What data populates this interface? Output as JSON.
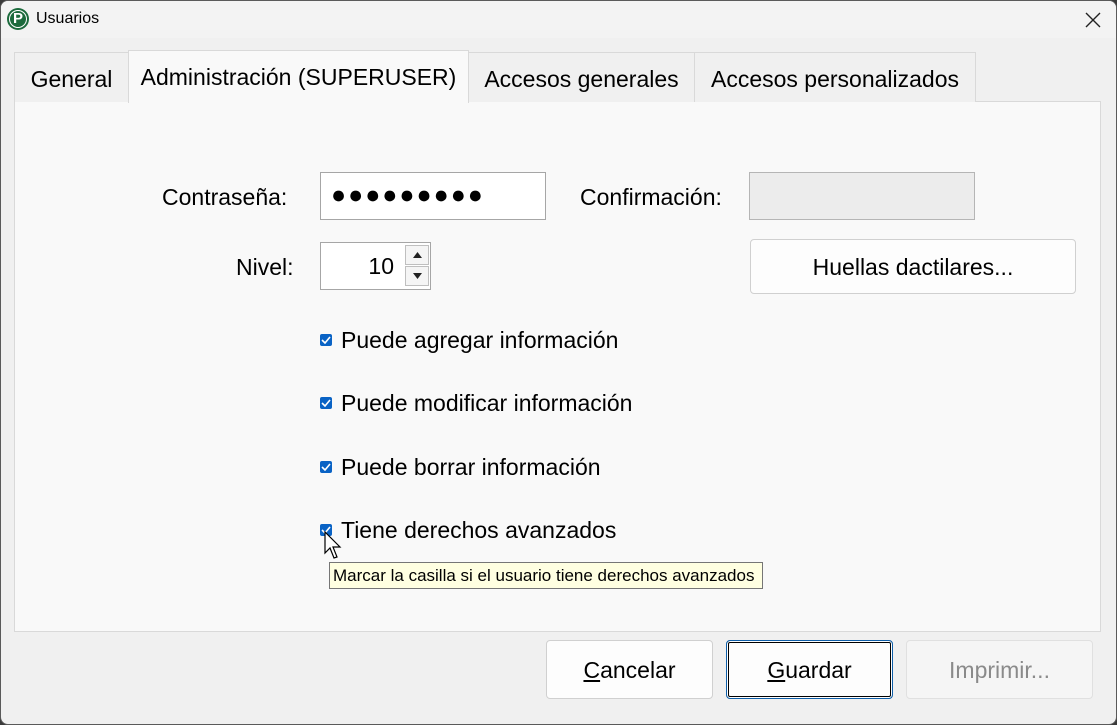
{
  "window": {
    "title": "Usuarios",
    "app_icon": "P"
  },
  "tabs": [
    {
      "label": "General",
      "active": false
    },
    {
      "label": "Administración (SUPERUSER)",
      "active": true
    },
    {
      "label": "Accesos generales",
      "active": false
    },
    {
      "label": "Accesos personalizados",
      "active": false
    }
  ],
  "form": {
    "password_label": "Contraseña:",
    "password_value": "●●●●●●●●●",
    "confirm_label": "Confirmación:",
    "confirm_value": "",
    "level_label": "Nivel:",
    "level_value": "10",
    "fingerprints_button": "Huellas dactilares..."
  },
  "checkboxes": [
    {
      "label": "Puede agregar información",
      "checked": true
    },
    {
      "label": "Puede modificar información",
      "checked": true
    },
    {
      "label": "Puede borrar información",
      "checked": true
    },
    {
      "label": "Tiene derechos avanzados",
      "checked": true
    }
  ],
  "tooltip": "Marcar la casilla si el usuario tiene derechos avanzados",
  "buttons": {
    "cancel": {
      "mnemonic": "C",
      "rest": "ancelar"
    },
    "save": {
      "mnemonic": "G",
      "rest": "uardar"
    },
    "print": "Imprimir..."
  },
  "colors": {
    "accent": "#0a63c5",
    "tooltip_bg": "#ffffe1",
    "app_icon": "#1b6a3c"
  }
}
